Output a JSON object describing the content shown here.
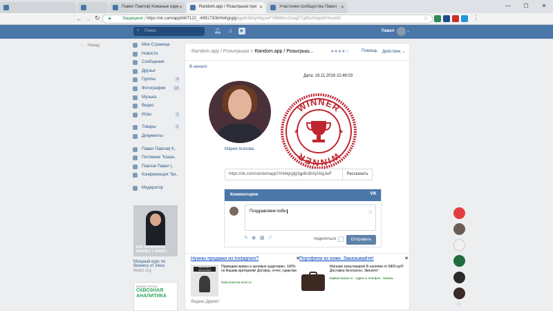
{
  "browser": {
    "tabs": [
      {
        "label": "Павел Павлов| Кожаные изде"
      },
      {
        "label": "Random.app / Розыгрыши при"
      },
      {
        "label": "Участники сообщества Павел"
      }
    ],
    "url_secure": "Защищено",
    "url": "https://vk.com/app5407122_-49917308#N4Igrglg",
    "url_rest": "3gpBcBtAjANgJwFYBM6Ac2AoqDTgBGANgiA8YAudAD"
  },
  "header": {
    "search_placeholder": "Поиск",
    "user_name": "Павел"
  },
  "back_label": "Назад",
  "nav": {
    "items": [
      {
        "label": "Моя Страница",
        "count": ""
      },
      {
        "label": "Новости",
        "count": ""
      },
      {
        "label": "Сообщения",
        "count": ""
      },
      {
        "label": "Друзья",
        "count": ""
      },
      {
        "label": "Группы",
        "count": "3"
      },
      {
        "label": "Фотографии",
        "count": "14"
      },
      {
        "label": "Музыка",
        "count": ""
      },
      {
        "label": "Видео",
        "count": ""
      },
      {
        "label": "Игры",
        "count": "1"
      }
    ],
    "items2": [
      {
        "label": "Товары",
        "count": "1"
      },
      {
        "label": "Документы",
        "count": ""
      }
    ],
    "items3": [
      {
        "label": "Павел Павлов| К.."
      },
      {
        "label": "Питомник \"Казан.."
      },
      {
        "label": "Павлов Павел |.."
      },
      {
        "label": "Конференция \"Би.."
      }
    ],
    "moderator": "Модератор"
  },
  "left_ad": {
    "image_text": "КАК ПРОКАЧАТЬ БИЗНЕС У АЯЗА?",
    "title": "Мощный курс по бизнесу от Аяза",
    "source": "lifebiz.org"
  },
  "left_ad2": {
    "brand": "MANGO OFFICE",
    "text": "СКВОЗНАЯ АНАЛИТИКА"
  },
  "main": {
    "crumb_root": "Random.app / Розыгрыши",
    "crumb_sep": ">",
    "crumb_current": "Random.app / Розыгрыш...",
    "stars": "★★★★☆",
    "help": "Помощь",
    "actions": "Действия ⌄",
    "to_start": "В начало",
    "date_line": "Дата: 19.11.2018 22:46:03",
    "winner_name": "Мария Агапова",
    "stamp_word": "WINNER",
    "link": "https://vk.com/randomapp?#N4Igrglg3gpBcBtAjANgJwF",
    "tell_button": "Рассказать",
    "comments": {
      "title": "Комментарии",
      "logo": "VK",
      "input_value": "Поздравляем побе",
      "share_label": "поделиться",
      "send_button": "Отправить"
    },
    "ads": [
      {
        "title": "Нужны продажи из Instagram?",
        "desc": "Приведем живую и целевую аудиторию. 100% по Вашим критериям! Договор, отчет, гарантии",
        "domain": "insta.moscow-smm.ru",
        "img_label": "РЕКЛАМА В ИНСТАГРАМ"
      },
      {
        "title": "Портфели из кожи. Заказывайте!",
        "desc": "Магазин канцтоваров! В наличии от 6800 руб! Доставка бесплатно. Звоните!",
        "domain": "kapitao-kazan.ru · Адрес и телефон · Казань"
      }
    ],
    "ad_close": "✕",
    "yandex_direct": "Яндекс.Директ"
  },
  "colors": {
    "vk_blue": "#4a76a8",
    "link": "#2a5885",
    "stamp_red": "#c0242f"
  }
}
